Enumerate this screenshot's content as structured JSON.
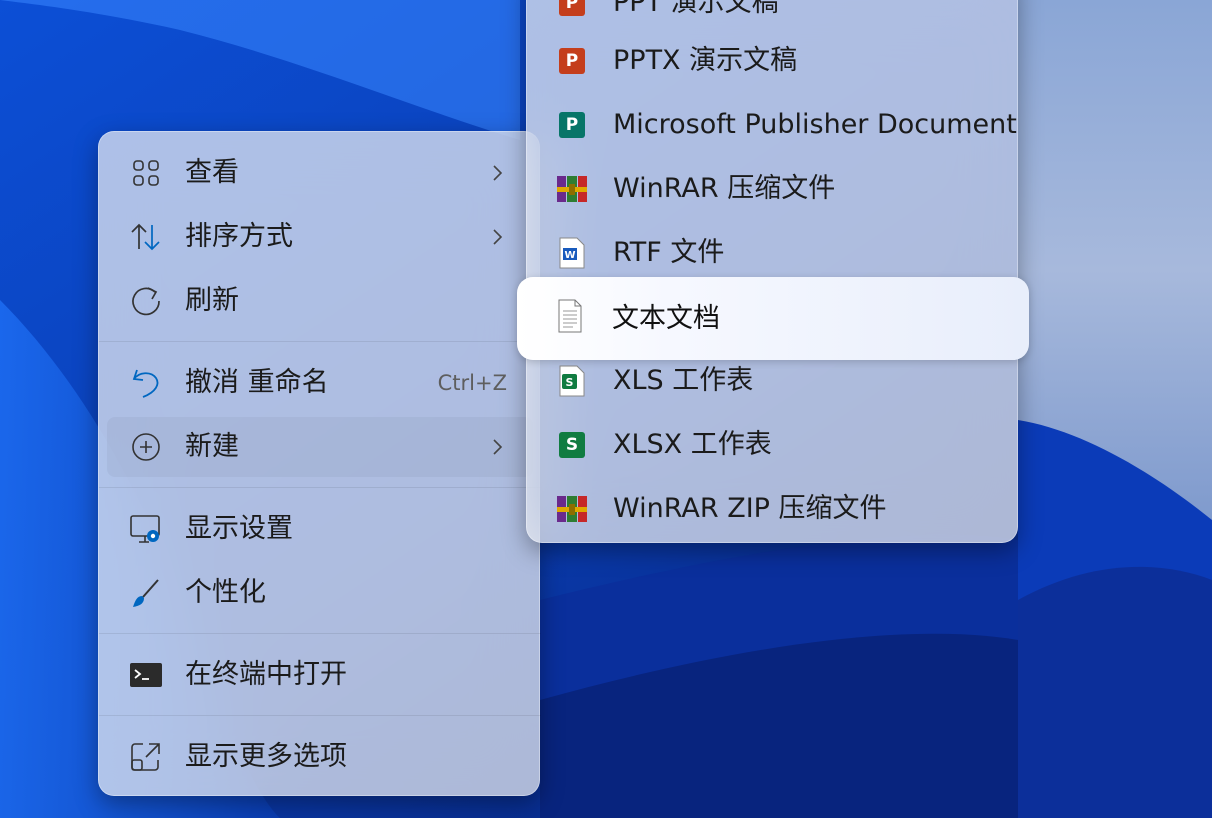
{
  "main_menu": {
    "items": [
      {
        "label": "查看",
        "icon": "grid-view-icon",
        "submenu": true
      },
      {
        "label": "排序方式",
        "icon": "sort-icon",
        "submenu": true
      },
      {
        "label": "刷新",
        "icon": "refresh-icon",
        "submenu": false
      },
      {
        "label": "撤消 重命名",
        "icon": "undo-icon",
        "shortcut": "Ctrl+Z"
      },
      {
        "label": "新建",
        "icon": "add-circle-icon",
        "submenu": true
      },
      {
        "label": "显示设置",
        "icon": "display-settings-icon"
      },
      {
        "label": "个性化",
        "icon": "brush-icon"
      },
      {
        "label": "在终端中打开",
        "icon": "terminal-icon"
      },
      {
        "label": "显示更多选项",
        "icon": "more-options-icon"
      }
    ]
  },
  "sub_menu": {
    "items": [
      {
        "label": "PPT 演示文稿",
        "icon": "powerpoint-icon"
      },
      {
        "label": "PPTX 演示文稿",
        "icon": "powerpoint-icon"
      },
      {
        "label": "Microsoft Publisher Document",
        "icon": "publisher-icon"
      },
      {
        "label": "WinRAR 压缩文件",
        "icon": "winrar-icon"
      },
      {
        "label": "RTF 文件",
        "icon": "word-doc-icon"
      },
      {
        "label": "文本文档",
        "icon": "text-document-icon",
        "selected": true
      },
      {
        "label": "XLS 工作表",
        "icon": "excel-icon"
      },
      {
        "label": "XLSX 工作表",
        "icon": "excel-icon"
      },
      {
        "label": "WinRAR ZIP 压缩文件",
        "icon": "winrar-icon"
      }
    ]
  },
  "colors": {
    "accent": "#0067c0",
    "powerpoint": "#c43e1c",
    "publisher": "#077568",
    "excel": "#107c41",
    "word": "#185abd"
  }
}
